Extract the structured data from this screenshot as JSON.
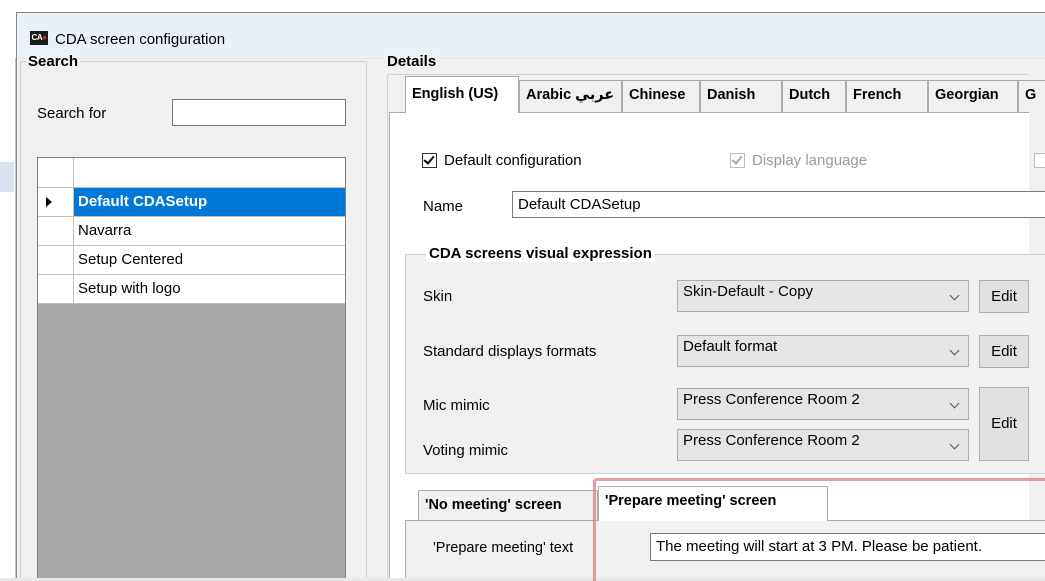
{
  "window": {
    "title": "CDA screen configuration",
    "icon": "cda-app-icon"
  },
  "search": {
    "group_title": "Search",
    "search_for_label": "Search for",
    "search_value": "",
    "rows": [
      {
        "name": "Default CDASetup",
        "selected": true
      },
      {
        "name": "Navarra",
        "selected": false
      },
      {
        "name": "Setup Centered",
        "selected": false
      },
      {
        "name": "Setup with logo",
        "selected": false
      }
    ]
  },
  "details": {
    "group_title": "Details",
    "tabs": [
      {
        "label": "English (US)",
        "active": true
      },
      {
        "label": "Arabic عربي",
        "active": false
      },
      {
        "label": "Chinese",
        "active": false
      },
      {
        "label": "Danish",
        "active": false
      },
      {
        "label": "Dutch",
        "active": false
      },
      {
        "label": "French",
        "active": false
      },
      {
        "label": "Georgian",
        "active": false
      },
      {
        "label": "G",
        "active": false
      }
    ],
    "default_configuration": {
      "label": "Default configuration",
      "checked": true
    },
    "display_language": {
      "label": "Display language",
      "checked": true,
      "enabled": false
    },
    "name_label": "Name",
    "name_value": "Default CDASetup",
    "visual": {
      "group_title": "CDA screens visual expression",
      "skin_label": "Skin",
      "skin_value": "Skin-Default - Copy",
      "formats_label": "Standard displays formats",
      "formats_value": "Default format",
      "mic_label": "Mic mimic",
      "mic_value": "Press Conference Room 2",
      "voting_label": "Voting mimic",
      "voting_value": "Press Conference Room 2",
      "edit_label": "Edit"
    },
    "screen_tabs": [
      {
        "label": "'No meeting' screen",
        "active": false
      },
      {
        "label": "'Prepare meeting' screen",
        "active": true
      }
    ],
    "prepare_text_label": "'Prepare meeting' text",
    "prepare_text_value": "The meeting will start at 3 PM. Please be patient."
  }
}
